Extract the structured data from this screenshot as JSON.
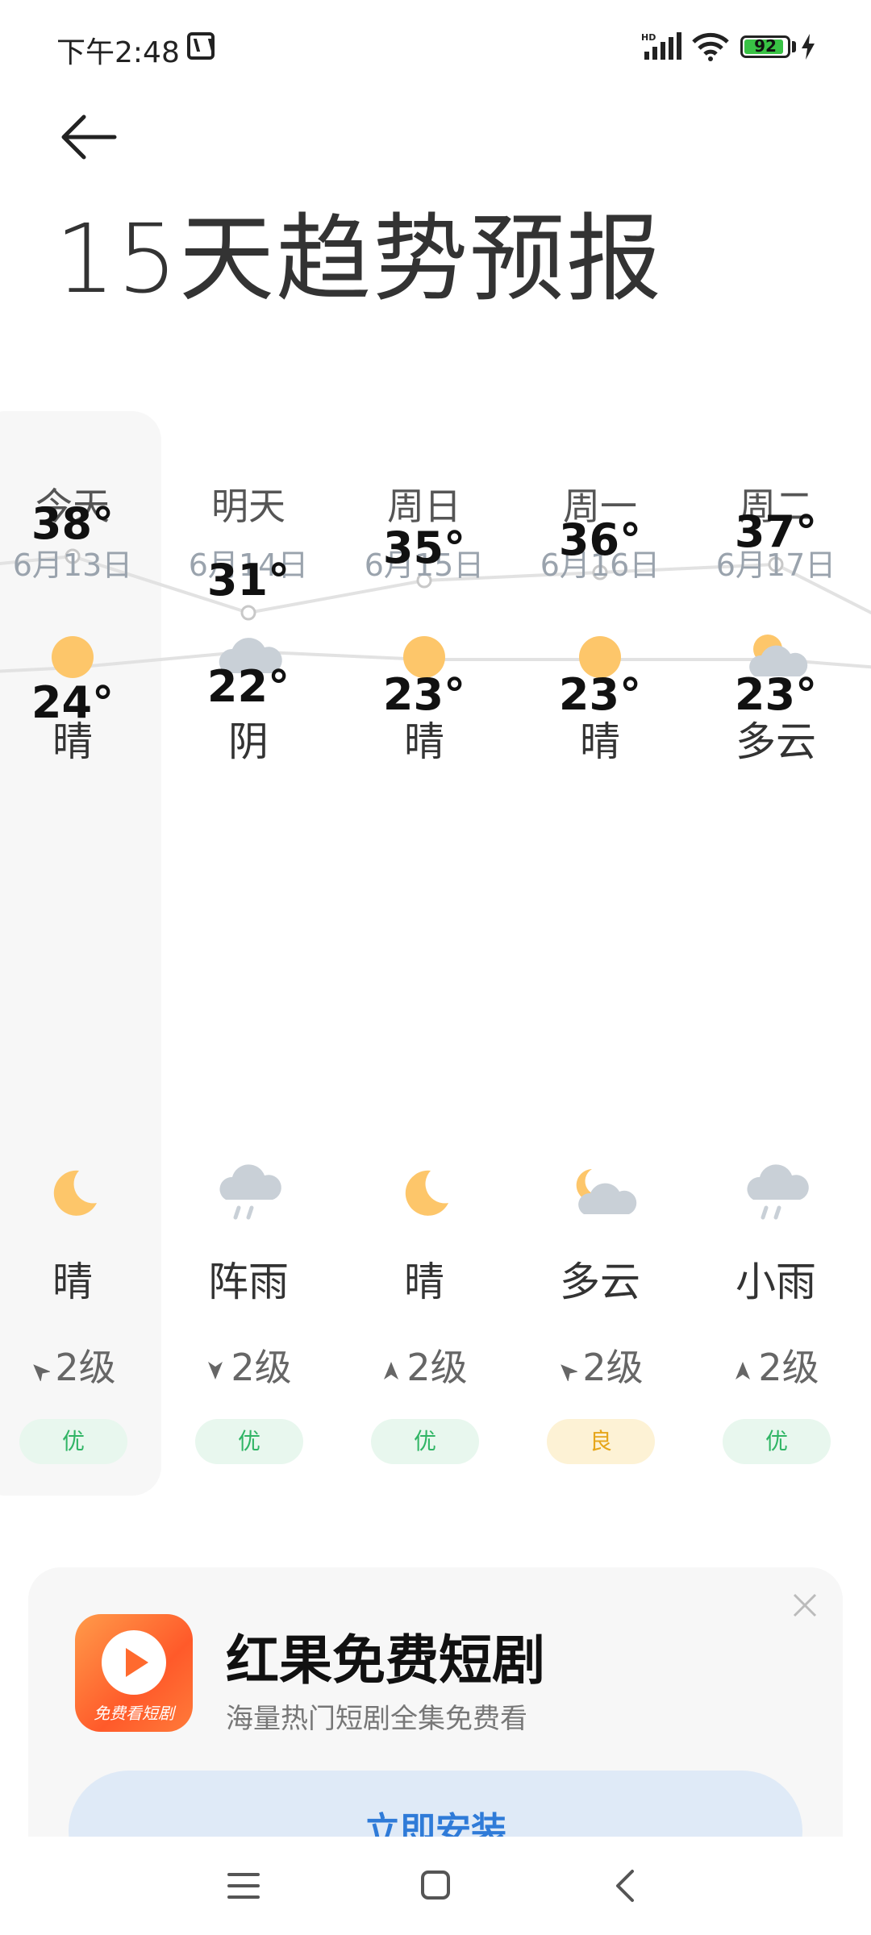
{
  "status_bar": {
    "time": "下午2:48",
    "signal_label": "HD",
    "battery": "92"
  },
  "header": {
    "back_icon": "arrow-left-icon",
    "title": "15天趋势预报"
  },
  "days": [
    {
      "name": "今天",
      "date": "6月13日",
      "day_icon": "sun",
      "day_condition": "晴",
      "high": "38°",
      "low": "24°",
      "night_icon": "moon",
      "night_condition": "晴",
      "wind_dir": "northwest",
      "wind_level": "2级",
      "aqi": "优",
      "aqi_status": "good",
      "selected": true
    },
    {
      "name": "明天",
      "date": "6月14日",
      "day_icon": "cloud",
      "day_condition": "阴",
      "high": "31°",
      "low": "22°",
      "night_icon": "rain",
      "night_condition": "阵雨",
      "wind_dir": "south",
      "wind_level": "2级",
      "aqi": "优",
      "aqi_status": "good"
    },
    {
      "name": "周日",
      "date": "6月15日",
      "day_icon": "sun",
      "day_condition": "晴",
      "high": "35°",
      "low": "23°",
      "night_icon": "moon",
      "night_condition": "晴",
      "wind_dir": "north",
      "wind_level": "2级",
      "aqi": "优",
      "aqi_status": "good"
    },
    {
      "name": "周一",
      "date": "6月16日",
      "day_icon": "sun",
      "day_condition": "晴",
      "high": "36°",
      "low": "23°",
      "night_icon": "moon-cloud",
      "night_condition": "多云",
      "wind_dir": "northwest",
      "wind_level": "2级",
      "aqi": "良",
      "aqi_status": "moderate"
    },
    {
      "name": "周二",
      "date": "6月17日",
      "day_icon": "sun-cloud",
      "day_condition": "多云",
      "high": "37°",
      "low": "23°",
      "night_icon": "rain",
      "night_condition": "小雨",
      "wind_dir": "north",
      "wind_level": "2级",
      "aqi": "优",
      "aqi_status": "good"
    }
  ],
  "chart_data": {
    "type": "line",
    "categories": [
      "6月13日",
      "6月14日",
      "6月15日",
      "6月16日",
      "6月17日"
    ],
    "series": [
      {
        "values": [
          38,
          31,
          35,
          36,
          37
        ]
      },
      {
        "values": [
          24,
          22,
          23,
          23,
          23
        ]
      }
    ]
  },
  "ad": {
    "app_icon_text": "免费看短剧",
    "title": "红果免费短剧",
    "subtitle": "海量热门短剧全集免费看",
    "install_label": "立即安装"
  },
  "colors": {
    "sun": "#fdc66a",
    "cloud": "#c9d0d7",
    "aqi_good_bg": "#e8f7ee",
    "aqi_moderate_bg": "#fdf2d5",
    "install_text": "#2f7bd8"
  }
}
